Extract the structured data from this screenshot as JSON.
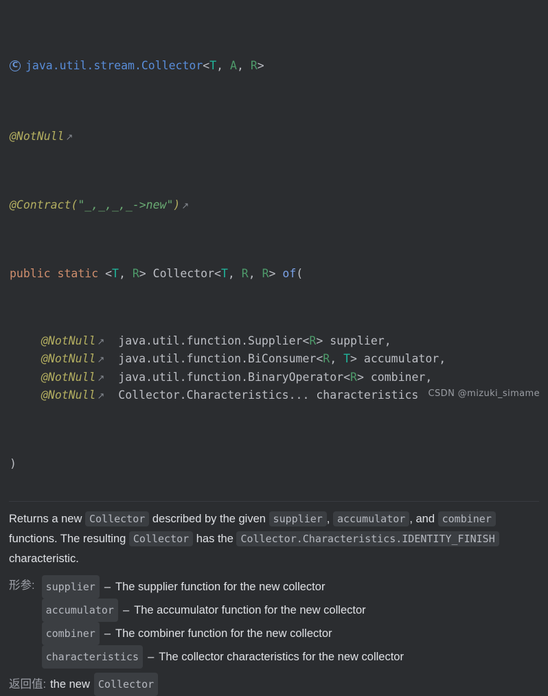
{
  "header": {
    "icon": "interface-class-icon",
    "fqn": "java.util.stream.Collector",
    "generic_open": "<",
    "type_t": "T",
    "sep1": ", ",
    "type_a": "A",
    "sep2": ", ",
    "type_r": "R",
    "generic_close": ">"
  },
  "signature": {
    "annotation_notnull": "@NotNull",
    "link_arrow": "↗",
    "annotation_contract_name": "@Contract(",
    "annotation_contract_value": "\"_,_,_,_->new\"",
    "annotation_contract_close": ")",
    "modifiers": "public static",
    "type_params_open": "<",
    "type_param_t": "T",
    "type_params_sep": ", ",
    "type_param_r": "R",
    "type_params_close": ">",
    "return_type": "Collector",
    "return_generic_open": "<",
    "return_t": "T",
    "return_sep1": ", ",
    "return_r1": "R",
    "return_sep2": ", ",
    "return_r2": "R",
    "return_generic_close": ">",
    "method_name": "of",
    "open_paren": "(",
    "close_paren": ")",
    "params": [
      {
        "annotation": "@NotNull",
        "arrow": "↗",
        "type": "java.util.function.Supplier",
        "generic_open": "<",
        "generic_args": [
          {
            "name": "R",
            "kind": "r"
          }
        ],
        "generic_close": ">",
        "name": "supplier",
        "trailing": ","
      },
      {
        "annotation": "@NotNull",
        "arrow": "↗",
        "type": "java.util.function.BiConsumer",
        "generic_open": "<",
        "generic_args": [
          {
            "name": "R",
            "kind": "r"
          },
          {
            "name": "T",
            "kind": "t"
          }
        ],
        "generic_close": ">",
        "name": "accumulator",
        "trailing": ","
      },
      {
        "annotation": "@NotNull",
        "arrow": "↗",
        "type": "java.util.function.BinaryOperator",
        "generic_open": "<",
        "generic_args": [
          {
            "name": "R",
            "kind": "r"
          }
        ],
        "generic_close": ">",
        "name": "combiner",
        "trailing": ","
      },
      {
        "annotation": "@NotNull",
        "arrow": "↗",
        "type": "Collector.Characteristics...",
        "generic_open": "",
        "generic_args": [],
        "generic_close": "",
        "name": "characteristics",
        "trailing": ""
      }
    ]
  },
  "doc": {
    "parts": [
      {
        "type": "text",
        "value": "Returns a new "
      },
      {
        "type": "code",
        "value": "Collector"
      },
      {
        "type": "text",
        "value": " described by the given "
      },
      {
        "type": "code",
        "value": "supplier"
      },
      {
        "type": "text",
        "value": ", "
      },
      {
        "type": "code",
        "value": "accumulator"
      },
      {
        "type": "text",
        "value": ", and "
      },
      {
        "type": "code",
        "value": "combiner"
      },
      {
        "type": "text",
        "value": " functions. The resulting "
      },
      {
        "type": "code",
        "value": "Collector"
      },
      {
        "type": "text",
        "value": " has the "
      },
      {
        "type": "code",
        "value": "Collector.Characteristics.IDENTITY_FINISH"
      },
      {
        "type": "text",
        "value": " characteristic."
      }
    ]
  },
  "params_section": {
    "label": "形参:",
    "rows": [
      {
        "name": "supplier",
        "dash": "–",
        "desc": "The supplier function for the new collector"
      },
      {
        "name": "accumulator",
        "dash": "–",
        "desc": "The accumulator function for the new collector"
      },
      {
        "name": "combiner",
        "dash": "–",
        "desc": "The combiner function for the new collector"
      },
      {
        "name": "characteristics",
        "dash": "–",
        "desc": "The collector characteristics for the new collector"
      }
    ]
  },
  "returns_section": {
    "label": "返回值:",
    "text": "the new",
    "code": "Collector"
  },
  "watermark": {
    "text": "CSDN @mizuki_simame"
  },
  "colors": {
    "background": "#2b2d30",
    "keyword": "#cf8e6d",
    "annotation": "#b3ae60",
    "string": "#6aab73",
    "generic_t": "#21b59b",
    "generic_r": "#4e9a6a",
    "method": "#7aa2e8",
    "fqn_link": "#598dd9",
    "text": "#dfe1e5",
    "chip_bg": "#3b3e42",
    "divider": "#393b40"
  }
}
